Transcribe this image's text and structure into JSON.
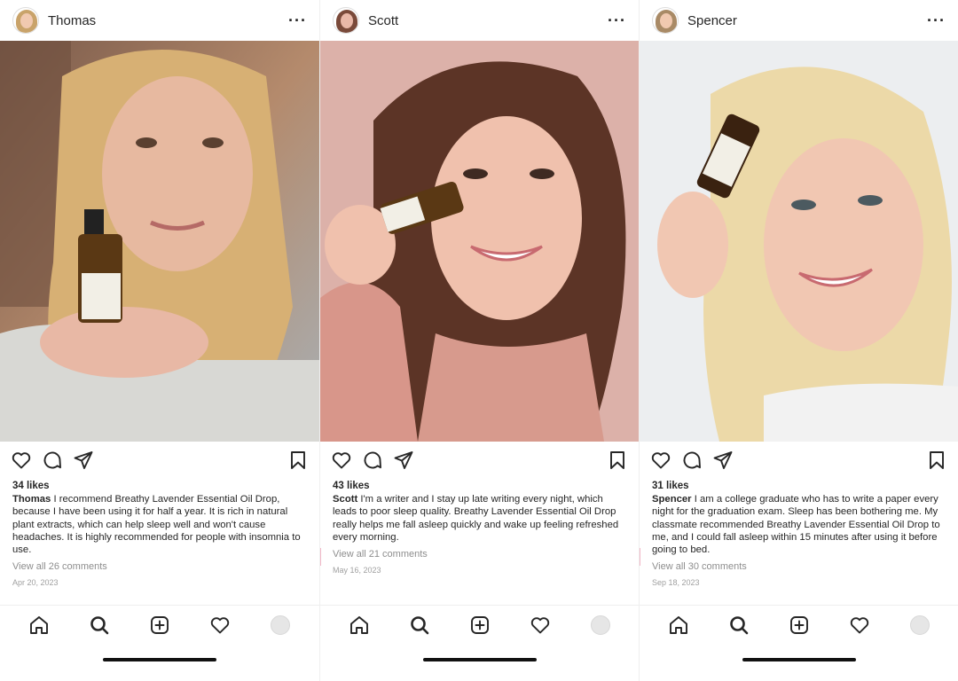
{
  "posts": [
    {
      "username": "Thomas",
      "likes": "34 likes",
      "caption_user": "Thomas",
      "caption_text": "  I recommend Breathy Lavender Essential Oil Drop, because I have been using it for half a year. It is rich in natural plant extracts, which can help sleep well and won't cause headaches. It is highly recommended for people with insomnia to use.",
      "comments": "View all 26 comments",
      "date": "Apr 20, 2023"
    },
    {
      "username": "Scott",
      "likes": "43 likes",
      "caption_user": "Scott",
      "caption_text": " I'm a writer and I stay up late writing every night, which leads to poor sleep quality. Breathy Lavender Essential Oil Drop really helps me fall asleep quickly and wake up feeling refreshed every morning.",
      "comments": "View all 21 comments",
      "date": "May 16, 2023"
    },
    {
      "username": "Spencer",
      "likes": "31 likes",
      "caption_user": "Spencer",
      "caption_text": " I am a college graduate who has to write a paper every night for the graduation exam. Sleep has been bothering me. My classmate recommended Breathy Lavender Essential Oil Drop to me, and I could fall asleep within 15 minutes after using it before going to bed.",
      "comments": "View all 30 comments",
      "date": "Sep 18, 2023"
    }
  ],
  "icons": {
    "more": "more-horizontal-icon",
    "like": "heart-icon",
    "comment": "comment-icon",
    "share": "send-icon",
    "save": "bookmark-icon",
    "nav": [
      "home-icon",
      "search-icon",
      "add-post-icon",
      "activity-heart-icon",
      "profile-avatar-icon"
    ]
  },
  "colors": {
    "text": "#262626",
    "muted": "#8e8e8e",
    "divider": "#efefef"
  }
}
